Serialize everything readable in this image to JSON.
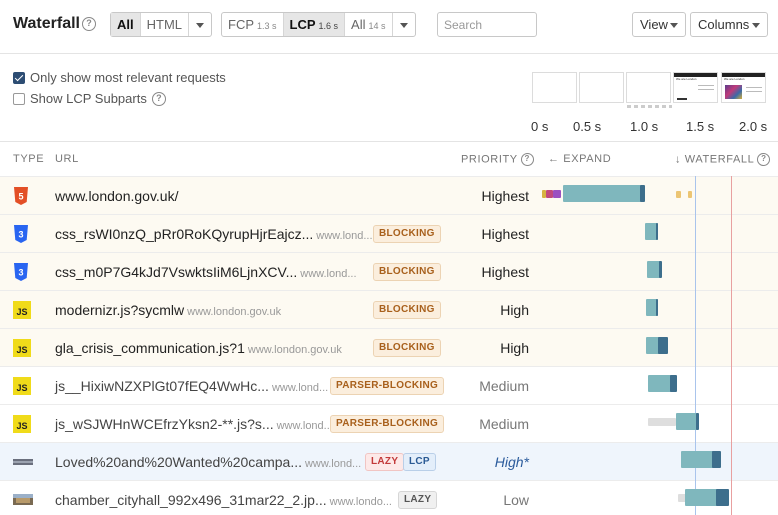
{
  "toolbar": {
    "title": "Waterfall",
    "type_filter": [
      "All",
      "HTML"
    ],
    "metrics": [
      {
        "label": "FCP",
        "time": "1.3 s"
      },
      {
        "label": "LCP",
        "time": "1.6 s"
      },
      {
        "label": "All",
        "time": "14 s"
      }
    ],
    "search_placeholder": "Search",
    "view_label": "View",
    "columns_label": "Columns"
  },
  "options": {
    "relevant_label": "Only show most relevant requests",
    "relevant_checked": true,
    "subparts_label": "Show LCP Subparts",
    "subparts_checked": false
  },
  "filmstrip": {
    "ticks": [
      "0 s",
      "0.5 s",
      "1.0 s",
      "1.5 s",
      "2.0 s"
    ],
    "frame_captions": [
      "We are London",
      "We are London"
    ]
  },
  "table": {
    "headers": {
      "type": "TYPE",
      "url": "URL",
      "priority": "PRIORITY",
      "expand": "← EXPAND",
      "waterfall": "↓ WATERFALL"
    },
    "rows": [
      {
        "type": "html",
        "type_text": "5",
        "url": "www.london.gov.uk/",
        "host": "",
        "badges": [],
        "priority": "Highest",
        "prio_style": "normal"
      },
      {
        "type": "css",
        "type_text": "3",
        "url": "css_rsWI0nzQ_pRr0RoKQyrupHjrEajcz...",
        "host": "www.lond...",
        "badges": [
          {
            "text": "BLOCKING",
            "kind": "block"
          }
        ],
        "priority": "Highest",
        "prio_style": "normal"
      },
      {
        "type": "css",
        "type_text": "3",
        "url": "css_m0P7G4kJd7VswktsIiM6LjnXCV...",
        "host": "www.lond...",
        "badges": [
          {
            "text": "BLOCKING",
            "kind": "block"
          }
        ],
        "priority": "Highest",
        "prio_style": "normal"
      },
      {
        "type": "js",
        "type_text": "JS",
        "url": "modernizr.js?sycmlw",
        "host": "www.london.gov.uk",
        "badges": [
          {
            "text": "BLOCKING",
            "kind": "block"
          }
        ],
        "priority": "High",
        "prio_style": "normal"
      },
      {
        "type": "js",
        "type_text": "JS",
        "url": "gla_crisis_communication.js?1",
        "host": "www.london.gov.uk",
        "badges": [
          {
            "text": "BLOCKING",
            "kind": "block"
          }
        ],
        "priority": "High",
        "prio_style": "normal"
      },
      {
        "type": "js",
        "type_text": "JS",
        "url": "js__HixiwNZXPlGt07fEQ4WwHc...",
        "host": "www.lond...",
        "badges": [
          {
            "text": "PARSER-BLOCKING",
            "kind": "block"
          }
        ],
        "priority": "Medium",
        "prio_style": "gray"
      },
      {
        "type": "js",
        "type_text": "JS",
        "url": "js_wSJWHnWCEfrzYksn2-**.js?s...",
        "host": "www.lond...",
        "badges": [
          {
            "text": "PARSER-BLOCKING",
            "kind": "block"
          }
        ],
        "priority": "Medium",
        "prio_style": "gray"
      },
      {
        "type": "img",
        "type_text": "",
        "url": "Loved%20and%20Wanted%20campa...",
        "host": "www.lond...",
        "badges": [
          {
            "text": "LAZY",
            "kind": "lazy"
          },
          {
            "text": "LCP",
            "kind": "lcp"
          }
        ],
        "priority": "High*",
        "prio_style": "blue"
      },
      {
        "type": "img",
        "type_text": "",
        "url": "chamber_cityhall_992x496_31mar22_2.jp...",
        "host": "www.londo...",
        "badges": [
          {
            "text": "LAZY",
            "kind": "lazy2"
          }
        ],
        "priority": "Low",
        "prio_style": "gray"
      }
    ]
  },
  "colors": {
    "html_icon": "#e34f26",
    "css_icon": "#2965f1",
    "js_icon": "#f0db1a",
    "download_bar": "#7fb7bd",
    "download_end": "#3d6e8c",
    "wait_bar": "#dedede",
    "fcp_line": "#a9c4ec",
    "lcp_line": "#e8a0a0"
  }
}
